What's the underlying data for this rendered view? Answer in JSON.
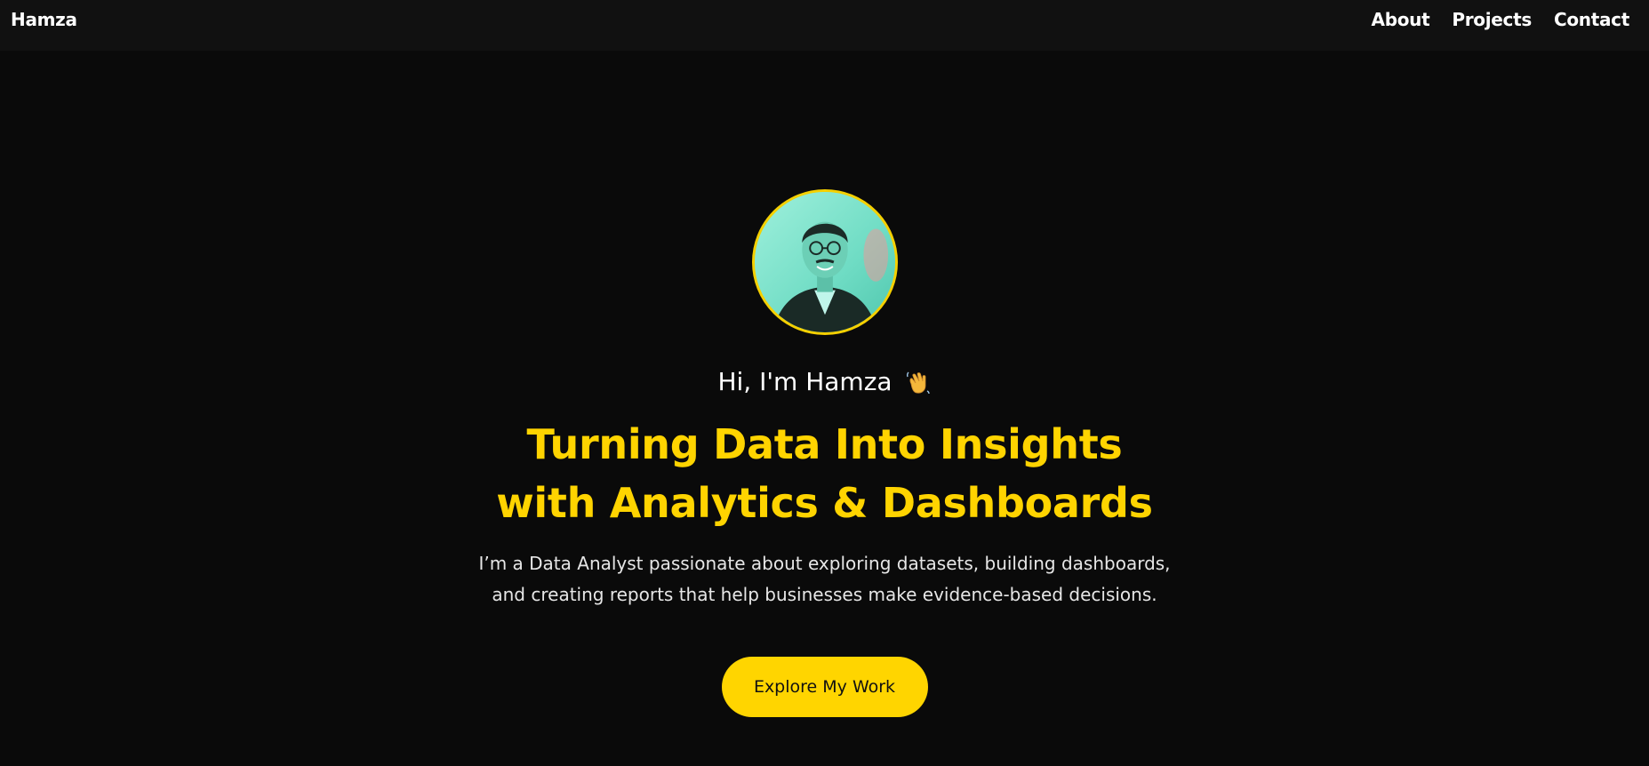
{
  "nav": {
    "brand": "Hamza",
    "links": [
      {
        "label": "About"
      },
      {
        "label": "Projects"
      },
      {
        "label": "Contact"
      }
    ]
  },
  "hero": {
    "avatar_icon": "profile-photo",
    "greeting": "Hi, I'm Hamza",
    "greeting_icon": "waving-hand-icon",
    "headline_line1": "Turning Data Into Insights",
    "headline_line2": "with Analytics & Dashboards",
    "description_line1": "I’m a Data Analyst passionate about exploring datasets, building dashboards,",
    "description_line2": "and creating reports that help businesses make evidence-based decisions.",
    "cta_label": "Explore My Work"
  },
  "colors": {
    "background": "#0a0a0a",
    "navbar": "#111111",
    "accent": "#ffd400",
    "text": "#ffffff"
  }
}
